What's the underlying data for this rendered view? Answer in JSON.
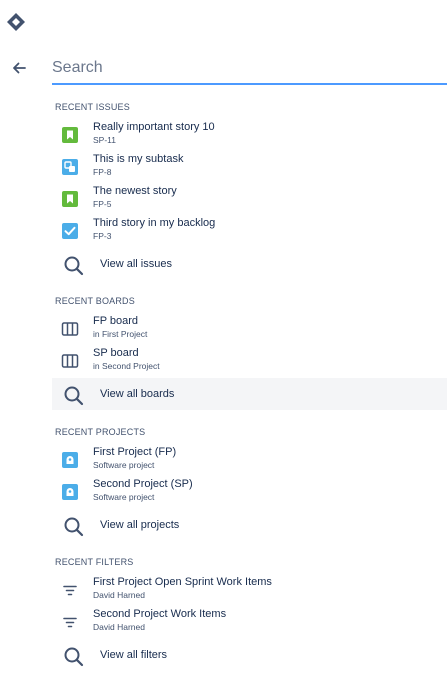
{
  "search": {
    "placeholder": "Search",
    "value": ""
  },
  "sections": {
    "issues": {
      "title": "RECENT ISSUES",
      "items": [
        {
          "name": "Really important story 10",
          "key": "SP-11",
          "icon": "story-icon"
        },
        {
          "name": "This is my subtask",
          "key": "FP-8",
          "icon": "subtask-icon"
        },
        {
          "name": "The newest story",
          "key": "FP-5",
          "icon": "story-icon"
        },
        {
          "name": "Third story in my backlog",
          "key": "FP-3",
          "icon": "task-icon"
        }
      ],
      "view_all": "View all issues"
    },
    "boards": {
      "title": "RECENT BOARDS",
      "items": [
        {
          "name": "FP board",
          "sub": "in First Project"
        },
        {
          "name": "SP board",
          "sub": "in Second Project"
        }
      ],
      "view_all": "View all boards"
    },
    "projects": {
      "title": "RECENT PROJECTS",
      "items": [
        {
          "name": "First Project (FP)",
          "sub": "Software project"
        },
        {
          "name": "Second Project (SP)",
          "sub": "Software project"
        }
      ],
      "view_all": "View all projects"
    },
    "filters": {
      "title": "RECENT FILTERS",
      "items": [
        {
          "name": "First Project Open Sprint Work Items",
          "sub": "David Harned"
        },
        {
          "name": "Second Project Work Items",
          "sub": "David Harned"
        }
      ],
      "view_all": "View all filters"
    }
  },
  "colors": {
    "story": "#63ba3c",
    "subtask": "#4bade8",
    "task": "#4bade8",
    "project": "#4bade8",
    "accent": "#4c9aff"
  }
}
